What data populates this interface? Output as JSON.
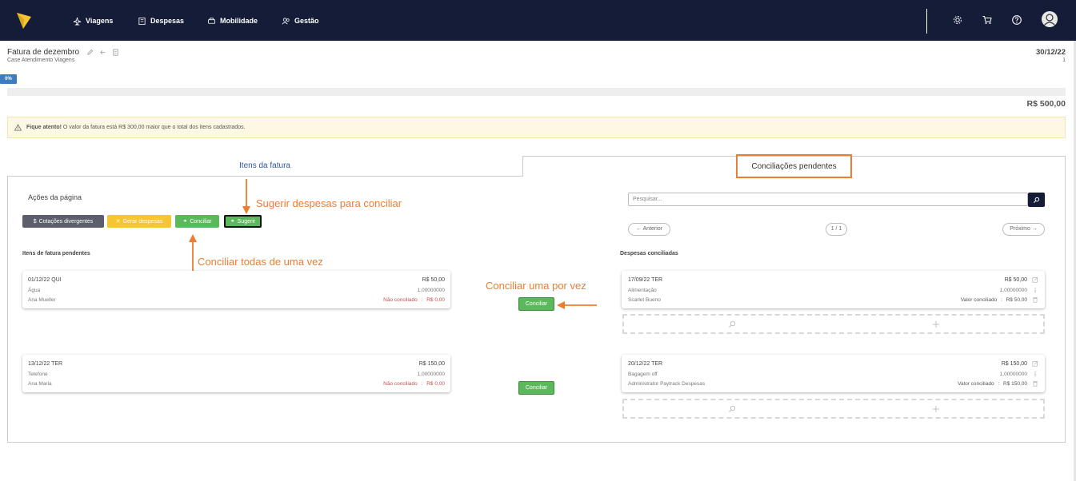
{
  "nav": {
    "items": [
      "Viagens",
      "Despesas",
      "Mobilidade",
      "Gestão"
    ]
  },
  "header": {
    "title": "Fatura de dezembro",
    "subtitle": "Case Atendimento Viagens",
    "date": "30/12/22",
    "page_num": "1",
    "progress_label": "0%",
    "progress_value": 0,
    "total": "R$ 500,00"
  },
  "alert": {
    "strong": "Fique atento!",
    "text": " O valor da fatura está R$ 300,00 maior que o total dos itens cadastrados."
  },
  "tabs": [
    "Itens da fatura",
    "Conciliações pendentes"
  ],
  "actions": {
    "title": "Ações da página",
    "buttons": [
      "Cotações divergentes",
      "Gerar despesas",
      "Conciliar",
      "Sugerir"
    ]
  },
  "search": {
    "placeholder": "Pesquisar..."
  },
  "pagination": {
    "prev": "← Anterior",
    "page": "1 / 1",
    "next": "Próximo →"
  },
  "left_section_title": "Itens de fatura pendentes",
  "right_section_title": "Despesas conciliadas",
  "pending_items": [
    {
      "date": "01/12/22 QUI",
      "amount": "R$ 50,00",
      "category": "Água",
      "qty": "1,00000000",
      "person": "Ana Mueller",
      "status": "Não conciliado",
      "sep": ":",
      "value": "R$ 0,00"
    },
    {
      "date": "13/12/22 TER",
      "amount": "R$ 150,00",
      "category": "Telefone",
      "qty": "1,00000000",
      "person": "Ana Maria",
      "status": "Não conciliado",
      "sep": ":",
      "value": "R$ 0,00"
    }
  ],
  "reconcile_button": "Conciliar",
  "reconciled_items": [
    {
      "date": "17/09/22 TER",
      "amount": "R$ 50,00",
      "category": "Alimentação",
      "qty": "1,00000000",
      "person": "Scarlet Bueno",
      "status": "Valor conciliado",
      "sep": ":",
      "value": "R$ 50,00"
    },
    {
      "date": "20/12/22 TER",
      "amount": "R$ 150,00",
      "category": "Bagagem off",
      "qty": "1,00000000",
      "person": "Administrator Paytrack Despesas",
      "status": "Valor conciliado",
      "sep": ":",
      "value": "R$ 150,00"
    }
  ],
  "annotations": {
    "sugerir": "Sugerir despesas para conciliar",
    "todas": "Conciliar todas de uma vez",
    "uma": "Conciliar uma por vez"
  },
  "colors": {
    "topbar": "#141c38",
    "accent": "#ed7d31",
    "green": "#5cb85c",
    "yellow": "#f5c533",
    "gray": "#5c5f6b",
    "tab_blue": "#2f5597"
  }
}
